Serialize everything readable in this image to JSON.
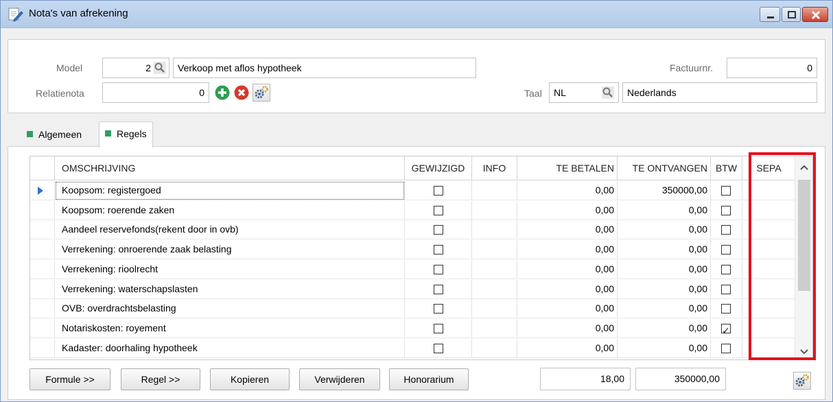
{
  "window": {
    "title": "Nota's van afrekening"
  },
  "header": {
    "model_label": "Model",
    "model_number": "2",
    "model_name": "Verkoop met aflos hypotheek",
    "factuurnr_label": "Factuurnr.",
    "factuurnr_value": "0",
    "relatienota_label": "Relatienota",
    "relatienota_value": "0",
    "taal_label": "Taal",
    "taal_code": "NL",
    "taal_name": "Nederlands"
  },
  "tabs": [
    {
      "label": "Algemeen",
      "active": false
    },
    {
      "label": "Regels",
      "active": true
    }
  ],
  "grid": {
    "columns": [
      "OMSCHRIJVING",
      "GEWIJZIGD",
      "INFO",
      "TE BETALEN",
      "TE ONTVANGEN",
      "BTW",
      "SEPA"
    ],
    "rows": [
      {
        "omschrijving": "Koopsom: registergoed",
        "gewijzigd": false,
        "te_betalen": "0,00",
        "te_ontvangen": "350000,00",
        "btw": false,
        "selected": true
      },
      {
        "omschrijving": "Koopsom: roerende zaken",
        "gewijzigd": false,
        "te_betalen": "0,00",
        "te_ontvangen": "0,00",
        "btw": false
      },
      {
        "omschrijving": "Aandeel reservefonds(rekent door in ovb)",
        "gewijzigd": false,
        "te_betalen": "0,00",
        "te_ontvangen": "0,00",
        "btw": false
      },
      {
        "omschrijving": "Verrekening: onroerende zaak belasting",
        "gewijzigd": false,
        "te_betalen": "0,00",
        "te_ontvangen": "0,00",
        "btw": false
      },
      {
        "omschrijving": "Verrekening: rioolrecht",
        "gewijzigd": false,
        "te_betalen": "0,00",
        "te_ontvangen": "0,00",
        "btw": false
      },
      {
        "omschrijving": "Verrekening: waterschapslasten",
        "gewijzigd": false,
        "te_betalen": "0,00",
        "te_ontvangen": "0,00",
        "btw": false
      },
      {
        "omschrijving": "OVB: overdrachtsbelasting",
        "gewijzigd": false,
        "te_betalen": "0,00",
        "te_ontvangen": "0,00",
        "btw": false
      },
      {
        "omschrijving": "Notariskosten: royement",
        "gewijzigd": false,
        "te_betalen": "0,00",
        "te_ontvangen": "0,00",
        "btw": true
      },
      {
        "omschrijving": "Kadaster: doorhaling hypotheek",
        "gewijzigd": false,
        "te_betalen": "0,00",
        "te_ontvangen": "0,00",
        "btw": false
      }
    ]
  },
  "footer": {
    "formule_label": "Formule >>",
    "regel_label": "Regel >>",
    "kopieren_label": "Kopieren",
    "verwijderen_label": "Verwijderen",
    "honorarium_label": "Honorarium",
    "total_te_betalen": "18,00",
    "total_te_ontvangen": "350000,00"
  },
  "colors": {
    "highlight": "#e3121e",
    "accent_green": "#2e9e65",
    "row_pointer": "#2f73c9"
  },
  "icons": [
    "note-edit-icon",
    "magnifier-icon",
    "add-icon",
    "delete-icon",
    "settings-gear-icon",
    "row-pointer-icon",
    "scroll-up-icon",
    "scroll-down-icon"
  ]
}
